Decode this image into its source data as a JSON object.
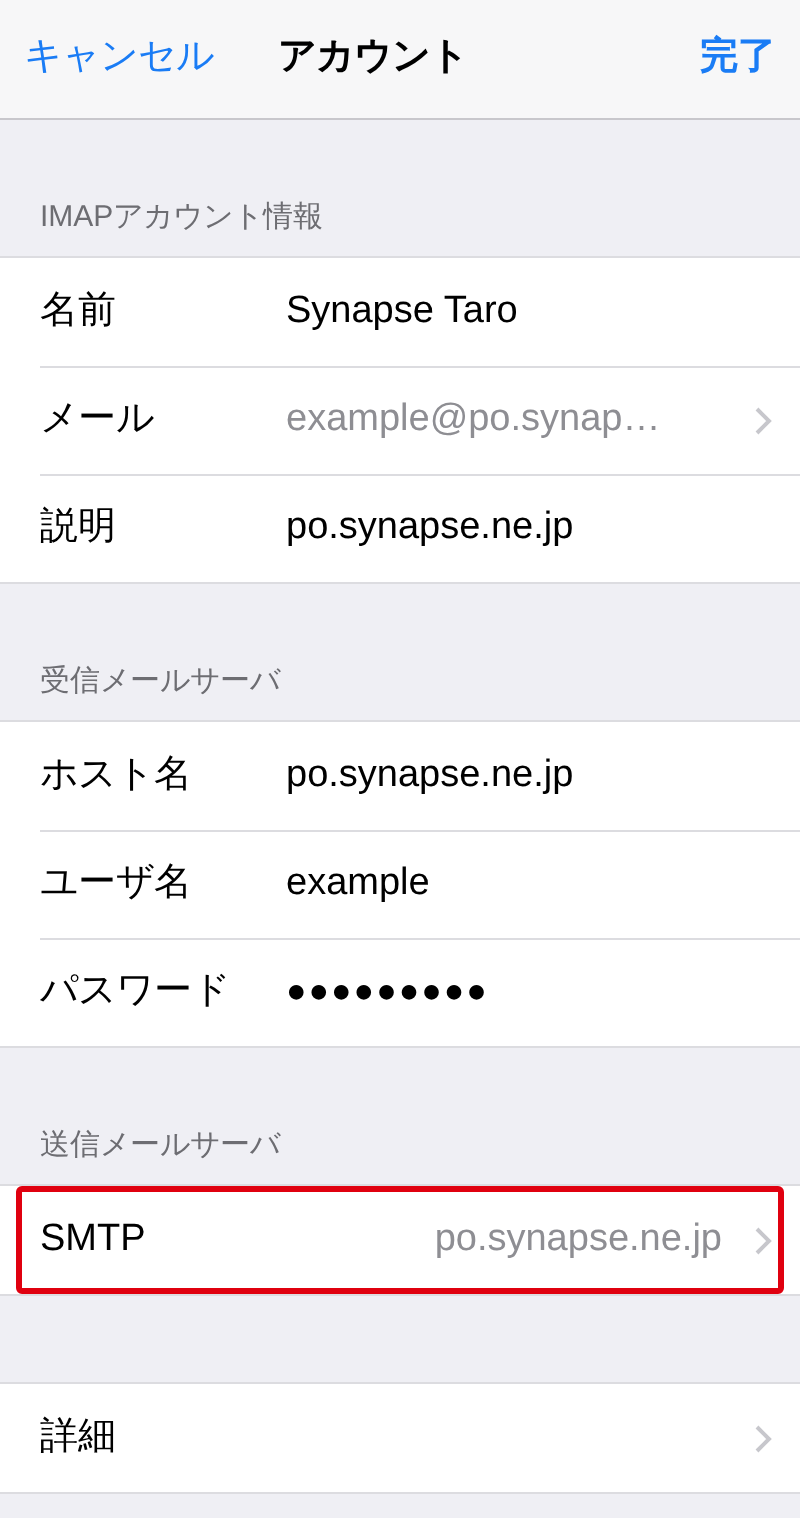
{
  "nav_bar": {
    "cancel": "キャンセル",
    "title": "アカウント",
    "done": "完了"
  },
  "sections": [
    {
      "header": "IMAPアカウント情報",
      "rows": [
        {
          "kind": "field",
          "label": "名前",
          "value": "Synapse Taro",
          "highlighted": false
        },
        {
          "kind": "info",
          "label": "メール",
          "value": "example@po.synap…",
          "highlighted": false
        },
        {
          "kind": "field",
          "label": "説明",
          "value": "po.synapse.ne.jp",
          "highlighted": false
        }
      ]
    },
    {
      "header": "受信メールサーバ",
      "rows": [
        {
          "kind": "field",
          "label": "ホスト名",
          "value": "po.synapse.ne.jp",
          "highlighted": false
        },
        {
          "kind": "field",
          "label": "ユーザ名",
          "value": "example",
          "highlighted": false
        },
        {
          "kind": "field",
          "label": "パスワード",
          "value": "●●●●●●●●●",
          "highlighted": false
        }
      ]
    },
    {
      "header": "送信メールサーバ",
      "rows": [
        {
          "kind": "detail",
          "label": "SMTP",
          "value": "po.synapse.ne.jp",
          "highlighted": true
        }
      ]
    },
    {
      "rows": [
        {
          "kind": "plain",
          "label": "詳細",
          "highlighted": false
        }
      ]
    }
  ]
}
